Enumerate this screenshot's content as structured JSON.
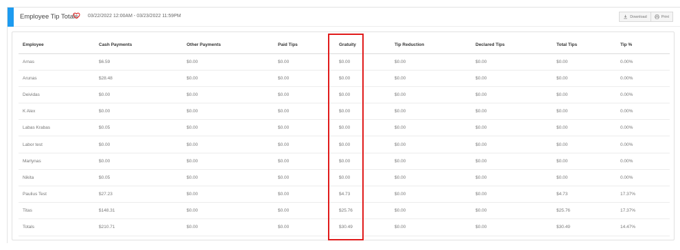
{
  "header": {
    "title": "Employee Tip Totals",
    "date_range": "03/22/2022 12:00AM - 03/23/2022 11:59PM",
    "favorite_icon": "heart-outline-icon",
    "accent_color": "#1d9bf0"
  },
  "actions": {
    "download_label": "Download",
    "print_label": "Print"
  },
  "table": {
    "columns": [
      "Employee",
      "Cash Payments",
      "Other Payments",
      "Paid Tips",
      "Gratuity",
      "Tip Reduction",
      "Declared Tips",
      "Total Tips",
      "Tip %"
    ],
    "rows": [
      [
        "Arnas",
        "$6.59",
        "$0.00",
        "$0.00",
        "$0.00",
        "$0.00",
        "$0.00",
        "$0.00",
        "0.00%"
      ],
      [
        "Arunas",
        "$28.48",
        "$0.00",
        "$0.00",
        "$0.00",
        "$0.00",
        "$0.00",
        "$0.00",
        "0.00%"
      ],
      [
        "Deividas",
        "$0.00",
        "$0.00",
        "$0.00",
        "$0.00",
        "$0.00",
        "$0.00",
        "$0.00",
        "0.00%"
      ],
      [
        "K Alex",
        "$0.00",
        "$0.00",
        "$0.00",
        "$0.00",
        "$0.00",
        "$0.00",
        "$0.00",
        "0.00%"
      ],
      [
        "Labas Krabas",
        "$0.05",
        "$0.00",
        "$0.00",
        "$0.00",
        "$0.00",
        "$0.00",
        "$0.00",
        "0.00%"
      ],
      [
        "Labor test",
        "$0.00",
        "$0.00",
        "$0.00",
        "$0.00",
        "$0.00",
        "$0.00",
        "$0.00",
        "0.00%"
      ],
      [
        "Martynas",
        "$0.00",
        "$0.00",
        "$0.00",
        "$0.00",
        "$0.00",
        "$0.00",
        "$0.00",
        "0.00%"
      ],
      [
        "Nikita",
        "$0.05",
        "$0.00",
        "$0.00",
        "$0.00",
        "$0.00",
        "$0.00",
        "$0.00",
        "0.00%"
      ],
      [
        "Paulius Test",
        "$27.23",
        "$0.00",
        "$0.00",
        "$4.73",
        "$0.00",
        "$0.00",
        "$4.73",
        "17.37%"
      ],
      [
        "Titas",
        "$148.31",
        "$0.00",
        "$0.00",
        "$25.76",
        "$0.00",
        "$0.00",
        "$25.76",
        "17.37%"
      ],
      [
        "Totals",
        "$210.71",
        "$0.00",
        "$0.00",
        "$30.49",
        "$0.00",
        "$0.00",
        "$30.49",
        "14.47%"
      ]
    ]
  },
  "highlight": {
    "column": "Gratuity",
    "color": "#e01919"
  }
}
